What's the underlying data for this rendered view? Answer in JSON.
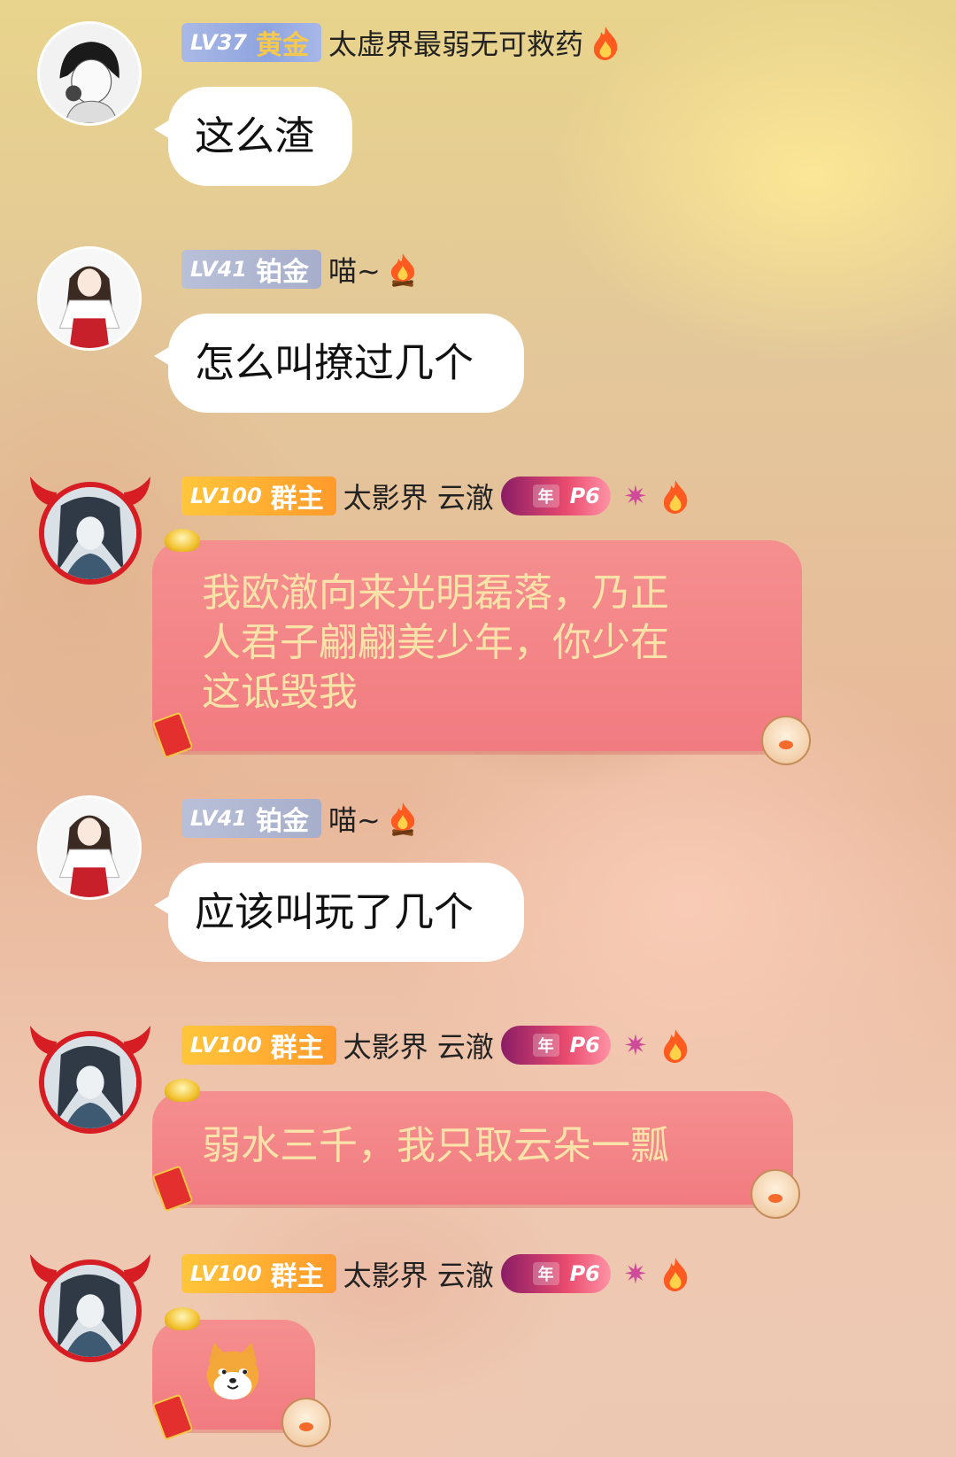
{
  "messages": [
    {
      "badge_level": "LV37",
      "badge_title": "黄金",
      "nickname": "太虚界最弱无可救药",
      "text": "这么渣"
    },
    {
      "badge_level": "LV41",
      "badge_title": "铂金",
      "nickname": "喵~",
      "text": "怎么叫撩过几个"
    },
    {
      "badge_level": "LV100",
      "badge_title": "群主",
      "nickname": "太影界  云澈",
      "tag_year": "年",
      "tag_level": "P6",
      "text_lines": [
        "我欧澈向来光明磊落，乃正",
        "人君子翩翩美少年，你少在",
        "这诋毁我"
      ]
    },
    {
      "badge_level": "LV41",
      "badge_title": "铂金",
      "nickname": "喵~",
      "text": "应该叫玩了几个"
    },
    {
      "badge_level": "LV100",
      "badge_title": "群主",
      "nickname": "太影界  云澈",
      "tag_year": "年",
      "tag_level": "P6",
      "text": "弱水三千，我只取云朵一瓢"
    },
    {
      "badge_level": "LV100",
      "badge_title": "群主",
      "nickname": "太影界  云澈",
      "tag_year": "年",
      "tag_level": "P6",
      "sticker": "shiba-dog-emoji"
    }
  ],
  "colors": {
    "owner_badge": "#ff9a2b",
    "gold_badge": "#8fa4df",
    "platinum_badge": "#a7aecb",
    "pink_bubble": "#f17b80",
    "pink_bubble_text": "#fbe2a9",
    "avatar_frame": "#d71d24"
  }
}
